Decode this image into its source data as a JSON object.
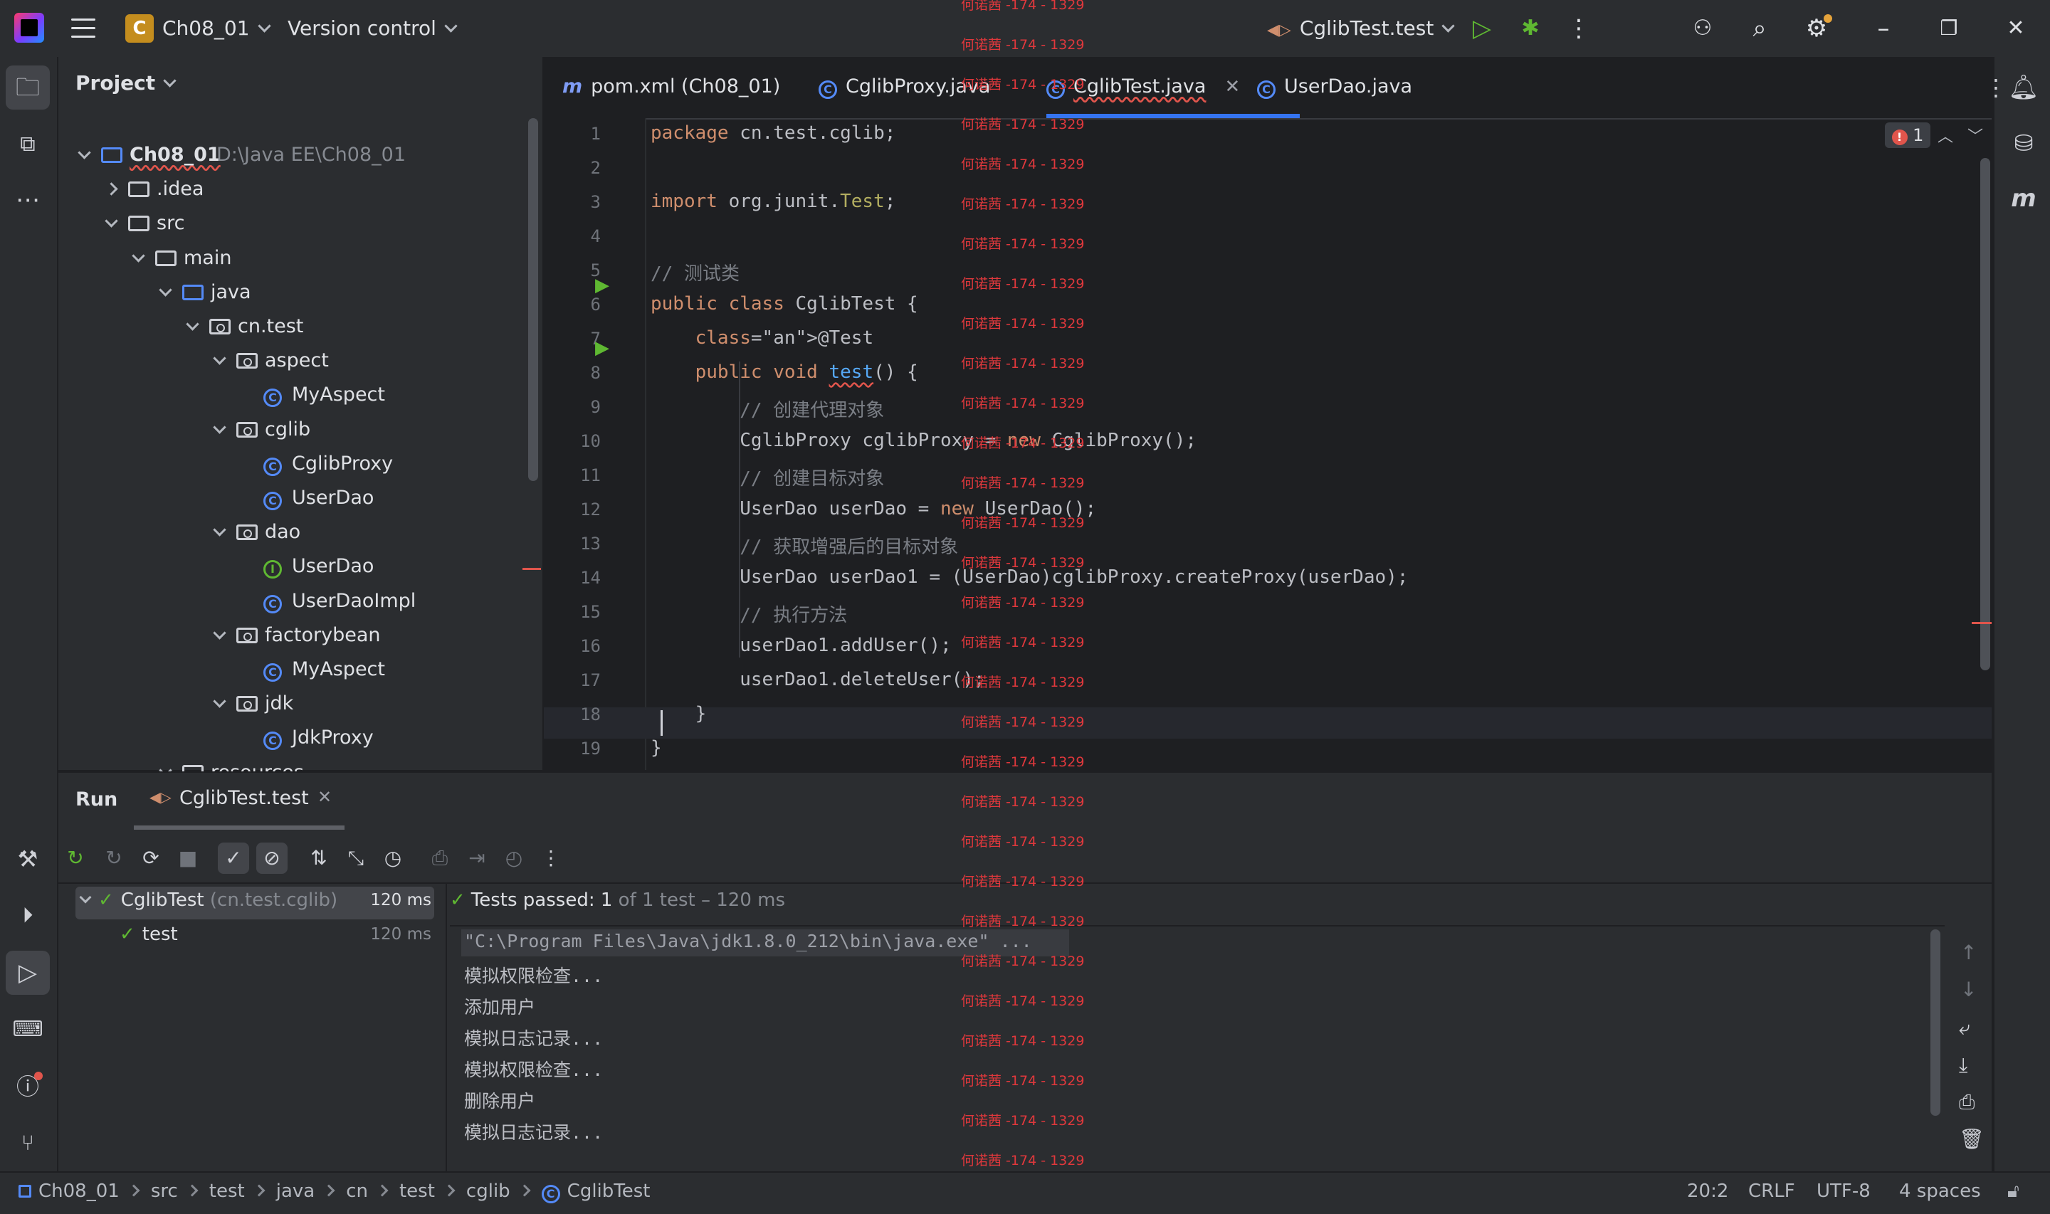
{
  "titlebar": {
    "project_initial": "C",
    "project_name": "Ch08_01",
    "vcs_label": "Version control",
    "run_config": "CglibTest.test"
  },
  "project_panel": {
    "title": "Project",
    "tree": [
      {
        "label": "Ch08_01",
        "extra": "D:\\Java EE\\Ch08_01",
        "depth": 0,
        "kind": "module",
        "open": true
      },
      {
        "label": ".idea",
        "depth": 1,
        "kind": "folder",
        "open": false
      },
      {
        "label": "src",
        "depth": 1,
        "kind": "folder",
        "open": true
      },
      {
        "label": "main",
        "depth": 2,
        "kind": "folder",
        "open": true
      },
      {
        "label": "java",
        "depth": 3,
        "kind": "source",
        "open": true
      },
      {
        "label": "cn.test",
        "depth": 4,
        "kind": "package",
        "open": true
      },
      {
        "label": "aspect",
        "depth": 5,
        "kind": "package",
        "open": true
      },
      {
        "label": "MyAspect",
        "depth": 6,
        "kind": "class"
      },
      {
        "label": "cglib",
        "depth": 5,
        "kind": "package",
        "open": true
      },
      {
        "label": "CglibProxy",
        "depth": 6,
        "kind": "class"
      },
      {
        "label": "UserDao",
        "depth": 6,
        "kind": "class"
      },
      {
        "label": "dao",
        "depth": 5,
        "kind": "package",
        "open": true
      },
      {
        "label": "UserDao",
        "depth": 6,
        "kind": "interface"
      },
      {
        "label": "UserDaoImpl",
        "depth": 6,
        "kind": "class"
      },
      {
        "label": "factorybean",
        "depth": 5,
        "kind": "package",
        "open": true
      },
      {
        "label": "MyAspect",
        "depth": 6,
        "kind": "class"
      },
      {
        "label": "jdk",
        "depth": 5,
        "kind": "package",
        "open": true
      },
      {
        "label": "JdkProxy",
        "depth": 6,
        "kind": "class"
      },
      {
        "label": "resources",
        "depth": 3,
        "kind": "resources",
        "open": true
      }
    ]
  },
  "editor": {
    "tabs": [
      {
        "label": "pom.xml (Ch08_01)",
        "icon": "maven-icon",
        "active": false
      },
      {
        "label": "CglibProxy.java",
        "icon": "class-icon",
        "active": false
      },
      {
        "label": "CglibTest.java",
        "icon": "class-icon",
        "active": true
      },
      {
        "label": "UserDao.java",
        "icon": "class-icon",
        "active": false
      }
    ],
    "error_count": "1",
    "lines": [
      "package cn.test.cglib;",
      "",
      "import org.junit.Test;",
      "",
      "// 测试类",
      "public class CglibTest {",
      "    @Test",
      "    public void test() {",
      "        // 创建代理对象",
      "        CglibProxy cglibProxy = new CglibProxy();",
      "        // 创建目标对象",
      "        UserDao userDao = new UserDao();",
      "        // 获取增强后的目标对象",
      "        UserDao userDao1 = (UserDao)cglibProxy.createProxy(userDao);",
      "        // 执行方法",
      "        userDao1.addUser();",
      "        userDao1.deleteUser();",
      "    }",
      "}",
      "`"
    ]
  },
  "watermark": "何诺茜 -174 - 1329",
  "run_panel": {
    "title": "Run",
    "tab_label": "CglibTest.test",
    "tree": [
      {
        "name": "CglibTest",
        "detail": "(cn.test.cglib)",
        "time": "120 ms"
      },
      {
        "name": "test",
        "detail": "",
        "time": "120 ms"
      }
    ],
    "status_bold": "Tests passed: 1",
    "status_rest": "of 1 test – 120 ms",
    "console": [
      "\"C:\\Program Files\\Java\\jdk1.8.0_212\\bin\\java.exe\" ...",
      "模拟权限检查...",
      "添加用户",
      "模拟日志记录...",
      "模拟权限检查...",
      "删除用户",
      "模拟日志记录..."
    ]
  },
  "statusbar": {
    "breadcrumb": [
      "Ch08_01",
      "src",
      "test",
      "java",
      "cn",
      "test",
      "cglib",
      "CglibTest"
    ],
    "position": "20:2",
    "line_sep": "CRLF",
    "encoding": "UTF-8",
    "indent": "4 spaces"
  },
  "colors": {
    "accent": "#3574f0",
    "error": "#e0554c",
    "success": "#5fb832",
    "project_badge": "#c48d1e"
  }
}
